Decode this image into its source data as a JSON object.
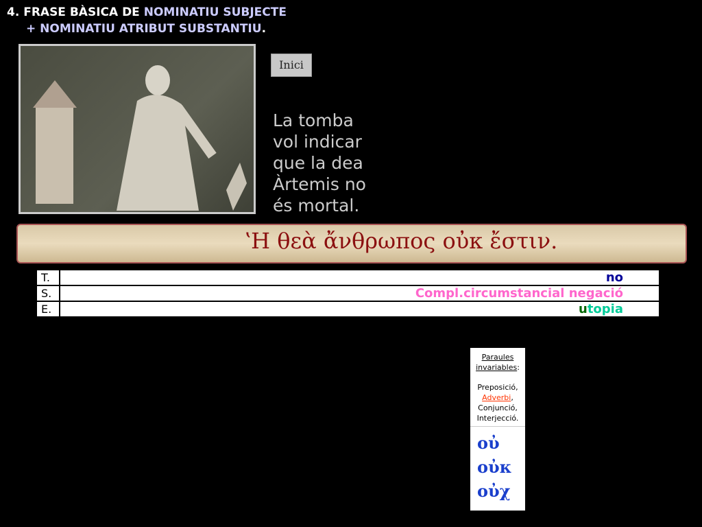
{
  "title": {
    "prefix": "4. FRASE BÀSICA DE ",
    "line1_hl": "NOMINATIU SUBJECTE",
    "line2": "+ NOMINATIU ATRIBUT SUBSTANTIU",
    "dot": "."
  },
  "inici_button": "Inici",
  "note": "  La tomba\nvol  indicar\nque la  dea\nÀrtemis no\nés mortal.",
  "greek_sentence": "ʽΗ  θεὰ  ἄνθρωπος  οὐκ  ἔστιν.",
  "table": [
    {
      "key": "T.",
      "value": "no",
      "color": "#000099"
    },
    {
      "key": "S.",
      "value": "Compl.circumstancial negació",
      "color": "#ff66cc"
    },
    {
      "key": "E.",
      "value_first": "u",
      "value_rest": "topia",
      "color_first": "#006600",
      "color_rest": "#00cc99"
    }
  ],
  "sidebox": {
    "heading1": "Paraules",
    "heading2": "invariables",
    "colon": ":",
    "items": [
      "Preposició,",
      "Adverbi",
      ",",
      "Conjunció,",
      "Interjecció."
    ],
    "accent": "#ff3300",
    "greek": [
      "οὐ",
      "οὐκ",
      "οὐχ"
    ]
  }
}
